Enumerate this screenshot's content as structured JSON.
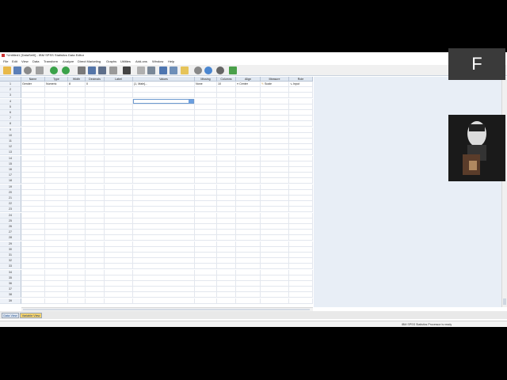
{
  "window": {
    "title": "*Untitled1 [DataSet0] - IBM SPSS Statistics Data Editor"
  },
  "menu": [
    "File",
    "Edit",
    "View",
    "Data",
    "Transform",
    "Analyze",
    "Direct Marketing",
    "Graphs",
    "Utilities",
    "Add-ons",
    "Window",
    "Help"
  ],
  "columns": [
    "Name",
    "Type",
    "Width",
    "Decimals",
    "Label",
    "Values",
    "Missing",
    "Columns",
    "Align",
    "Measure",
    "Role"
  ],
  "variables": [
    {
      "name": "Gender",
      "type": "Numeric",
      "width": "8",
      "decimals": "0",
      "label": "",
      "values": "{1, Male}...",
      "missing": "None",
      "columns": "10",
      "align": "Center",
      "measure": "Scale",
      "role": "Input"
    }
  ],
  "row_numbers": [
    "1",
    "2",
    "3",
    "4",
    "5",
    "6",
    "7",
    "8",
    "9",
    "10",
    "11",
    "12",
    "13",
    "14",
    "15",
    "16",
    "17",
    "18",
    "19",
    "20",
    "21",
    "22",
    "23",
    "24",
    "25",
    "26",
    "27",
    "28",
    "29",
    "30",
    "31",
    "32",
    "33",
    "34",
    "35",
    "36",
    "37",
    "38",
    "39"
  ],
  "tabs": {
    "data_view": "Data View",
    "variable_view": "Variable View"
  },
  "status": "IBM SPSS Statistics Processor is ready",
  "overlay_letter": "F",
  "toolbar_icons": [
    "open-icon",
    "save-icon",
    "print-icon",
    "dialog-recall-icon",
    "undo-icon",
    "redo-icon",
    "goto-case-icon",
    "goto-variable-icon",
    "variables-icon",
    "find-icon",
    "insert-cases-icon",
    "insert-variable-icon",
    "split-file-icon",
    "weight-cases-icon",
    "select-cases-icon",
    "value-labels-icon",
    "use-sets-icon",
    "spelling-icon"
  ],
  "colors": {
    "accent": "#f6d36b",
    "header_bg": "#dfe7f1",
    "tab_active": "#f6d36b"
  }
}
